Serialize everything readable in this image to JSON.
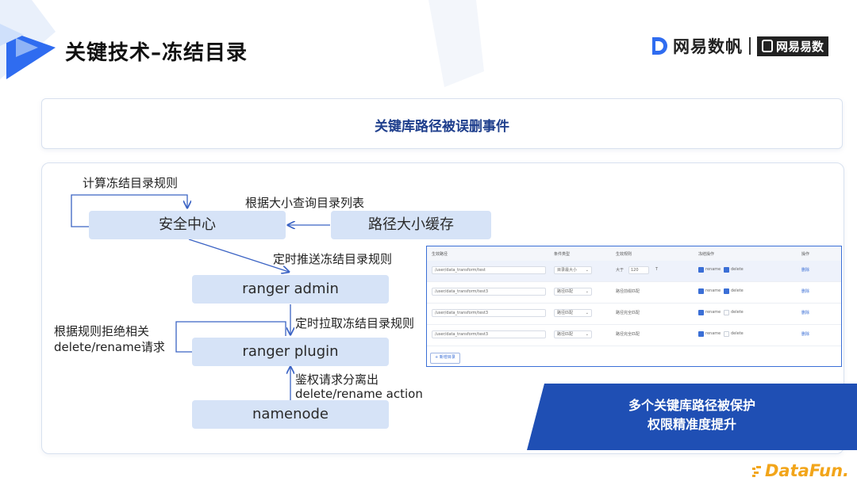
{
  "slide": {
    "title": "关键技术–冻结目录",
    "brand": {
      "primary": "网易数帆",
      "secondary": "网易易数"
    },
    "footer_brand": "DataFun.",
    "colors": {
      "accent": "#1f4fb4",
      "node_fill": "#d6e3f7",
      "arrow": "#3b63c4",
      "datafun": "#f2a51a"
    }
  },
  "event": {
    "text": "关键库路径被误删事件"
  },
  "diagram": {
    "nodes": {
      "security_center": "安全中心",
      "path_size_cache": "路径大小缓存",
      "ranger_admin": "ranger admin",
      "ranger_plugin": "ranger plugin",
      "namenode": "namenode"
    },
    "labels": {
      "compute_rules": "计算冻结目录规则",
      "query_by_size": "根据大小查询目录列表",
      "push_rules": "定时推送冻结目录规则",
      "pull_rules": "定时拉取冻结目录规则",
      "reject_line1": "根据规则拒绝相关",
      "reject_line2": "delete/rename请求",
      "auth_line1": "鉴权请求分离出",
      "auth_line2": "delete/rename action"
    }
  },
  "table": {
    "headers": {
      "path": "生效路径",
      "condition": "条件类型",
      "rule": "生效规则",
      "freeze": "冻结操作",
      "ops": "操作"
    },
    "rows": [
      {
        "path": "/user/data_transform/test",
        "type": "目录最大小",
        "rule": "大于",
        "size": "120",
        "unit": "T",
        "rename_checked": true,
        "delete_checked": true,
        "action": "删除"
      },
      {
        "path": "/user/data_transform/test3",
        "type": "路径匹配",
        "rule": "路径前缀匹配",
        "rename_checked": true,
        "delete_checked": true,
        "action": "删除"
      },
      {
        "path": "/user/data_transform/test3",
        "type": "路径匹配",
        "rule": "路径完全匹配",
        "rename_checked": true,
        "delete_checked": false,
        "action": "删除"
      },
      {
        "path": "/user/data_transform/test3",
        "type": "路径匹配",
        "rule": "路径完全匹配",
        "rename_checked": true,
        "delete_checked": false,
        "action": "删除"
      }
    ],
    "checkbox_labels": {
      "rename": "rename",
      "delete": "delete"
    },
    "add_button": "+ 新增目录"
  },
  "callout": {
    "line1": "多个关键库路径被保护",
    "line2": "权限精准度提升"
  }
}
